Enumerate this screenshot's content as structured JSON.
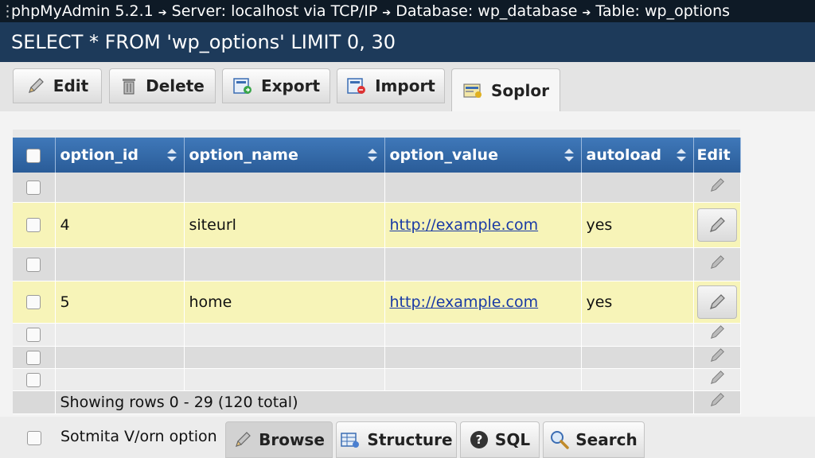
{
  "breadcrumb": {
    "app": "phpMyAdmin 5.2.1",
    "server": "Server: localhost via TCP/IP",
    "database": "Database: wp_database",
    "table": "Table: wp_options"
  },
  "query": "SELECT * FROM 'wp_options' LIMIT 0, 30",
  "top_tabs": [
    {
      "label": "Edit",
      "icon": "pencil-icon"
    },
    {
      "label": "Delete",
      "icon": "trash-icon"
    },
    {
      "label": "Export",
      "icon": "export-icon"
    },
    {
      "label": "Import",
      "icon": "import-icon"
    },
    {
      "label": "Soplor",
      "icon": "sql-box-icon",
      "active": true
    }
  ],
  "table": {
    "columns": [
      "option_id",
      "option_name",
      "option_value",
      "autoload",
      "Edit"
    ],
    "rows": [
      {
        "option_id": "",
        "option_name": "",
        "option_value": "",
        "autoload": ""
      },
      {
        "option_id": "4",
        "option_name": "siteurl",
        "option_value": "http://example.com",
        "autoload": "yes"
      },
      {
        "option_id": "",
        "option_name": "",
        "option_value": "",
        "autoload": ""
      },
      {
        "option_id": "5",
        "option_name": "home",
        "option_value": "http://example.com",
        "autoload": "yes"
      },
      {
        "option_id": "",
        "option_name": "",
        "option_value": "",
        "autoload": ""
      },
      {
        "option_id": "",
        "option_name": "",
        "option_value": "",
        "autoload": ""
      },
      {
        "option_id": "",
        "option_name": "",
        "option_value": "",
        "autoload": ""
      }
    ],
    "footer": "Showing rows 0 - 29 (120 total)"
  },
  "bottom": {
    "with_selected": "Sotmita V/orn option",
    "tabs": [
      {
        "label": "Browse",
        "icon": "pencil-icon",
        "active": true
      },
      {
        "label": "Structure",
        "icon": "structure-icon"
      },
      {
        "label": "SQL",
        "icon": "help-icon"
      },
      {
        "label": "Search",
        "icon": "search-icon"
      }
    ]
  },
  "colors": {
    "breadcrumb_bg": "#0e1a26",
    "query_bg": "#1d3a5a",
    "header_bg": "#2f67a8",
    "highlight_row": "#f7f4b8",
    "link": "#1a3aa5"
  }
}
